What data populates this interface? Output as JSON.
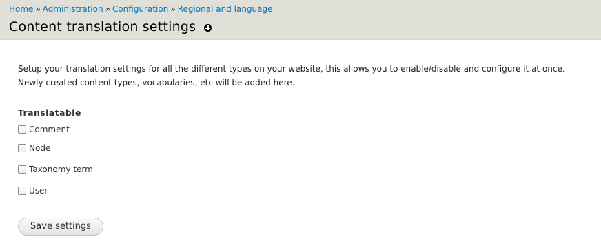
{
  "breadcrumb": {
    "items": [
      "Home",
      "Administration",
      "Configuration",
      "Regional and language"
    ],
    "separator": "»"
  },
  "page": {
    "title": "Content translation settings",
    "shortcut_icon": "add-shortcut-icon"
  },
  "main": {
    "description": "Setup your translation settings for all the different types on your website, this allows you to enable/disable and configure it at once. Newly created content types, vocabularies, etc will be added here.",
    "fieldset_title": "Translatable",
    "options": [
      {
        "label": "Comment",
        "checked": false
      },
      {
        "label": "Node",
        "checked": false
      },
      {
        "label": "Taxonomy term",
        "checked": false
      },
      {
        "label": "User",
        "checked": false
      }
    ],
    "save_label": "Save settings"
  },
  "colors": {
    "header_bg": "#e0e0d8",
    "link": "#0074bd",
    "title": "#000000",
    "text": "#333333"
  }
}
